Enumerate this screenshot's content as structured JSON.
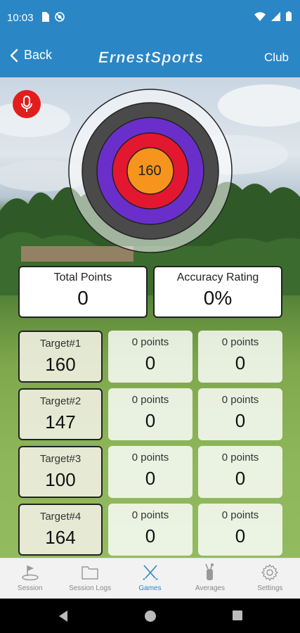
{
  "status_bar": {
    "time": "10:03"
  },
  "app_bar": {
    "back_label": "Back",
    "brand": "ErnestSports",
    "club_label": "Club"
  },
  "target": {
    "center_value": "160"
  },
  "stats": {
    "total_points_label": "Total Points",
    "total_points_value": "0",
    "accuracy_label": "Accuracy Rating",
    "accuracy_value": "0%"
  },
  "rows": [
    {
      "target_label": "Target#1",
      "target_value": "160",
      "cells": [
        {
          "label": "0 points",
          "value": "0"
        },
        {
          "label": "0 points",
          "value": "0"
        }
      ]
    },
    {
      "target_label": "Target#2",
      "target_value": "147",
      "cells": [
        {
          "label": "0 points",
          "value": "0"
        },
        {
          "label": "0 points",
          "value": "0"
        }
      ]
    },
    {
      "target_label": "Target#3",
      "target_value": "100",
      "cells": [
        {
          "label": "0 points",
          "value": "0"
        },
        {
          "label": "0 points",
          "value": "0"
        }
      ]
    },
    {
      "target_label": "Target#4",
      "target_value": "164",
      "cells": [
        {
          "label": "0 points",
          "value": "0"
        },
        {
          "label": "0 points",
          "value": "0"
        }
      ]
    }
  ],
  "nav": [
    {
      "label": "Session",
      "icon": "golf-hole-icon"
    },
    {
      "label": "Session Logs",
      "icon": "folder-icon"
    },
    {
      "label": "Games",
      "icon": "crossed-clubs-icon",
      "active": true
    },
    {
      "label": "Averages",
      "icon": "golf-bag-icon"
    },
    {
      "label": "Settings",
      "icon": "gear-icon"
    }
  ],
  "colors": {
    "primary": "#2b86c5",
    "ring_outer": "#4a4a4a",
    "ring_purple": "#6a2fcb",
    "ring_red": "#e3172f",
    "bullseye": "#f7941d",
    "mic": "#e31d1d"
  }
}
